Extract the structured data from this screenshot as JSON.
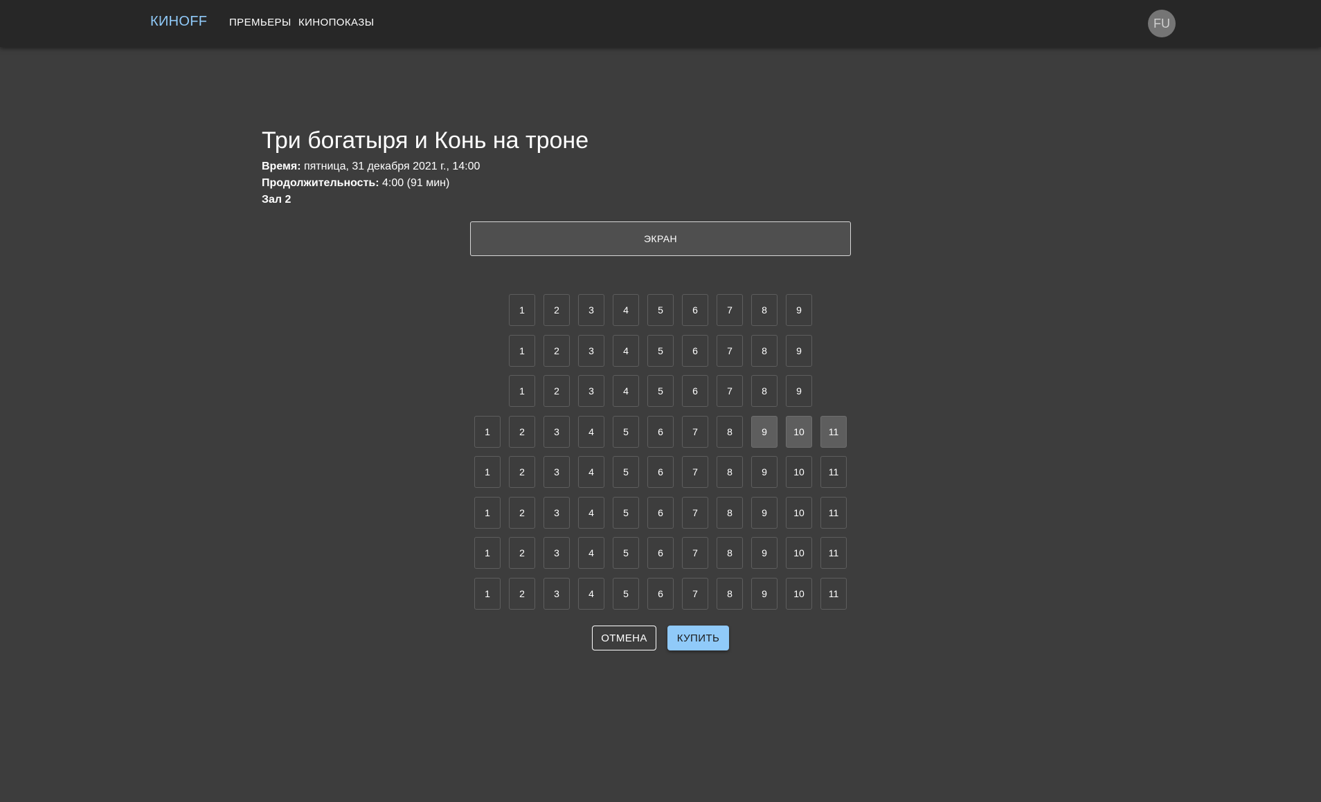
{
  "appbar": {
    "brand": "КИНОFF",
    "nav": [
      "ПРЕМЬЕРЫ",
      "КИНОПОКАЗЫ"
    ],
    "avatar_initials": "FU"
  },
  "session": {
    "title": "Три богатыря и Конь на троне",
    "time_label": "Время:",
    "time_value": "пятница, 31 декабря 2021 г., 14:00",
    "duration_label": "Продолжительность:",
    "duration_value": "4:00 (91 мин)",
    "hall": "Зал 2"
  },
  "screen_label": "ЭКРАН",
  "seat_rows": [
    {
      "seats": 9,
      "selected": []
    },
    {
      "seats": 9,
      "selected": []
    },
    {
      "seats": 9,
      "selected": []
    },
    {
      "seats": 11,
      "selected": [
        9,
        10,
        11
      ]
    },
    {
      "seats": 11,
      "selected": []
    },
    {
      "seats": 11,
      "selected": []
    },
    {
      "seats": 11,
      "selected": []
    },
    {
      "seats": 11,
      "selected": []
    }
  ],
  "actions": {
    "cancel": "ОТМЕНА",
    "buy": "КУПИТЬ"
  },
  "colors": {
    "background": "#3d3d3d",
    "appbar": "#272727",
    "accent": "#90caf9",
    "seat_selected": "#5e5e5e"
  }
}
